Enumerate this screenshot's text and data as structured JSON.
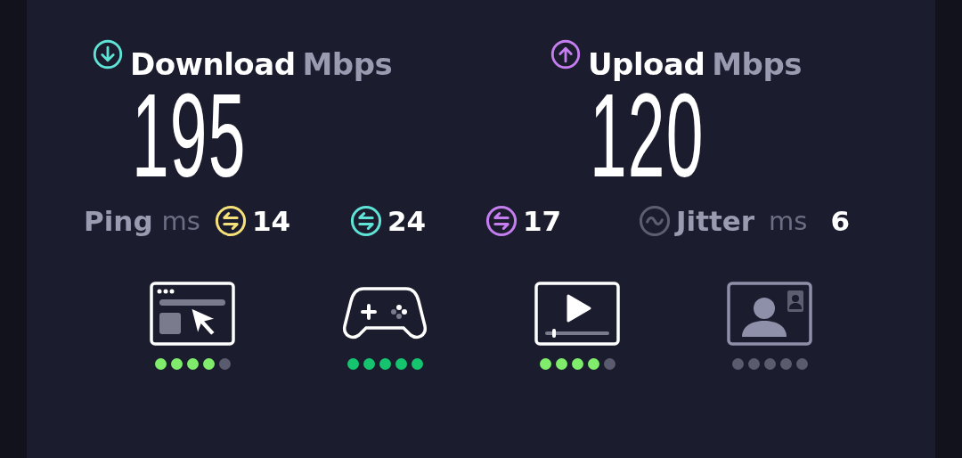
{
  "speeds": [
    {
      "kind": "download",
      "label": "Download",
      "unit": "Mbps",
      "value": "195"
    },
    {
      "kind": "upload",
      "label": "Upload",
      "unit": "Mbps",
      "value": "120"
    }
  ],
  "ping": {
    "label": "Ping",
    "unit": "ms",
    "readings": [
      {
        "value": "14",
        "color": "#f5e07a"
      },
      {
        "value": "24",
        "color": "#5fe3d6"
      },
      {
        "value": "17",
        "color": "#c57ef0"
      }
    ]
  },
  "jitter": {
    "label": "Jitter",
    "unit": "ms",
    "value": "6"
  },
  "activities": [
    {
      "kind": "browsing",
      "disabled": false,
      "stars": 4,
      "color": "#80ec6c"
    },
    {
      "kind": "gaming",
      "disabled": false,
      "stars": 5,
      "color": "#16c470"
    },
    {
      "kind": "streaming",
      "disabled": false,
      "stars": 4,
      "color": "#80ec6c"
    },
    {
      "kind": "video_call",
      "disabled": true,
      "stars": 0
    }
  ]
}
